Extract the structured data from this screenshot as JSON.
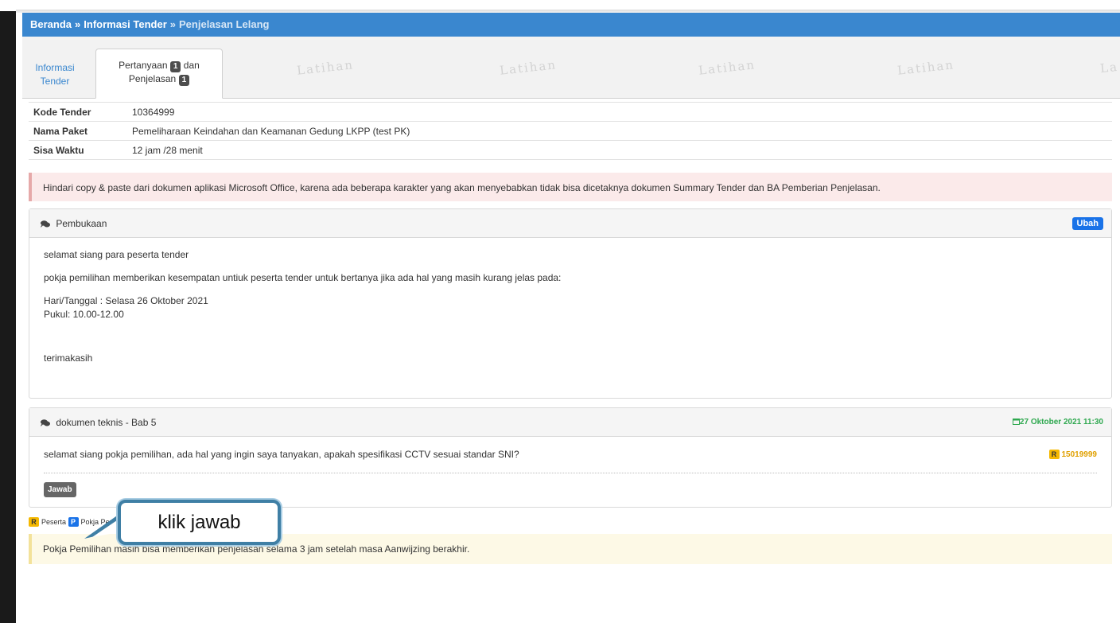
{
  "breadcrumb": {
    "home": "Beranda",
    "sep1": "»",
    "section": "Informasi Tender",
    "sep2": "»",
    "current": "Penjelasan Lelang"
  },
  "tabs": {
    "info_line1": "Informasi",
    "info_line2": "Tender",
    "qa_part1": "Pertanyaan",
    "qa_badge1": "1",
    "qa_part2": "dan",
    "qa_line2": "Penjelasan",
    "qa_badge2": "1"
  },
  "watermark": [
    "Latihan",
    "Latihan",
    "Latihan",
    "Latihan",
    "La"
  ],
  "info": {
    "kode_label": "Kode Tender",
    "kode_value": "10364999",
    "nama_label": "Nama Paket",
    "nama_value": "Pemeliharaan Keindahan dan Keamanan Gedung LKPP (test PK)",
    "sisa_label": "Sisa Waktu",
    "sisa_value": "12 jam /28 menit"
  },
  "alert": "Hindari copy & paste dari dokumen aplikasi Microsoft Office, karena ada beberapa karakter yang akan menyebabkan tidak bisa dicetaknya dokumen Summary Tender dan BA Pemberian Penjelasan.",
  "pembukaan": {
    "title": "Pembukaan",
    "edit_label": "Ubah",
    "line1": "selamat siang para peserta tender",
    "line2": "pokja pemilihan memberikan kesempatan untiuk peserta tender untuk bertanya jika ada hal yang masih kurang jelas pada:",
    "line3": "Hari/Tanggal : Selasa 26 Oktober 2021",
    "line4": "Pukul: 10.00-12.00",
    "line5": "terimakasih"
  },
  "question": {
    "title": "dokumen teknis - Bab 5",
    "date": "27 Oktober 2021 11:30",
    "text": "selamat siang pokja pemilihan, ada hal yang ingin saya tanyakan, apakah spesifikasi CCTV sesuai standar SNI?",
    "role_badge": "R",
    "user_id": "15019999",
    "answer_label": "Jawab"
  },
  "legend": {
    "r_badge": "R",
    "r_label": "Peserta",
    "p_badge": "P",
    "p_label": "Pokja Pemilihan"
  },
  "notice": "Pokja Pemilihan masih bisa memberikan penjelasan selama 3 jam setelah masa Aanwijzing berakhir.",
  "callout": "klik jawab",
  "colors": {
    "breadcrumb_bg": "#3a87cf",
    "ubah_btn": "#1a73e8",
    "date_green": "#2ea84f",
    "role_yellow": "#f5b800",
    "callout_border": "#3f7fa5"
  }
}
